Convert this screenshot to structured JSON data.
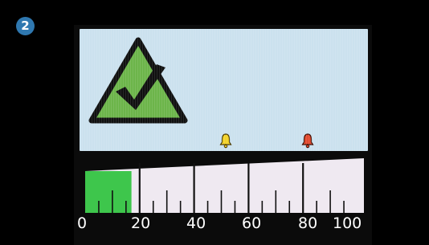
{
  "step": "2",
  "status_icon": "check-warning-triangle-icon",
  "alarms": [
    {
      "name": "alarm-yellow-icon",
      "color": "#F3D32A",
      "value": 50
    },
    {
      "name": "alarm-red-icon",
      "color": "#E14A2F",
      "value": 80
    }
  ],
  "gauge": {
    "min": 0,
    "max": 100,
    "value": 17,
    "tick_labels": [
      "0",
      "20",
      "40",
      "60",
      "80",
      "100"
    ]
  },
  "colors": {
    "lcd_bg": "#CBE1EE",
    "gauge_fill": "#3EC64C",
    "triangle_fill": "#6CB54A",
    "triangle_border": "#101010"
  }
}
